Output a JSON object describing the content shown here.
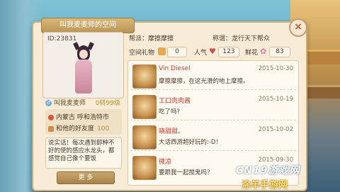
{
  "panel": {
    "title": "叫我麦麦师的空间",
    "close_label": "×"
  },
  "profile": {
    "id": "ID:23831",
    "name": "叫我麦麦师",
    "level": "0转99级",
    "location": "内蒙古  呼和浩特市",
    "favor_label": "和他的好友度",
    "favor_value": "100",
    "bio": "说实话！每次遇到即种不好的使的感应水龙头，都感觉自己像个要饭",
    "more_label": "更 多"
  },
  "stats": {
    "faction_label": "帮派：",
    "faction_value": "摩擦摩擦",
    "title_label": "称谓：",
    "title_value": "龙行天下帮众",
    "gift_label": "空间礼物",
    "gift_value": "0",
    "popularity_label": "人气",
    "popularity_value": "123",
    "flower_label": "鲜花",
    "flower_value": "83"
  },
  "feed": [
    {
      "name": "Vin Diesel",
      "message": "摩擦摩擦，在这光滑的地上摩擦。",
      "date": "2015-10-30"
    },
    {
      "name": "工口肉肉酱",
      "message": "吃了吗？",
      "date": "2015-10-19"
    },
    {
      "name": "晓甜甜。",
      "message": "大话西游超好玩的:-D！",
      "date": "2015-10-02"
    },
    {
      "name": "微凉",
      "message": "要跟我一起搅鬼吗？",
      "date": "2015-09-30"
    }
  ],
  "watermark": {
    "line1": "CN19游戏网",
    "line2": "涂羊手游网"
  },
  "colors": {
    "panel_bg": "#f8ecd6",
    "accent_gold": "#b8902d",
    "friend_name": "#c23a2a"
  }
}
